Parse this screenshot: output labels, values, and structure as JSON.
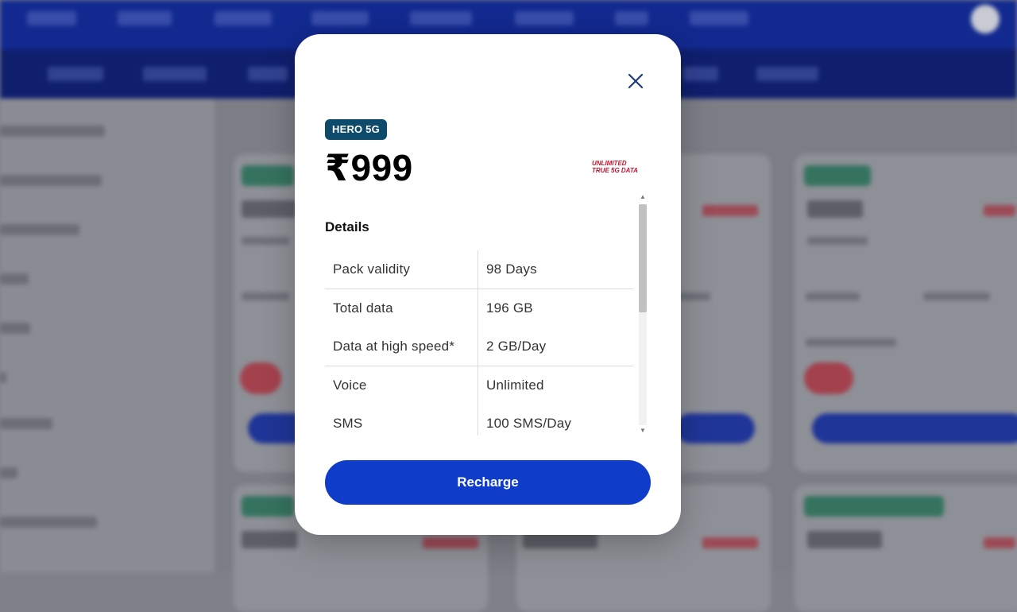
{
  "modal": {
    "badge": "HERO 5G",
    "price": "₹999",
    "tag_5g_line1": "UNLIMITED",
    "tag_5g_line2": "TRUE 5G DATA",
    "details_heading": "Details",
    "details": [
      {
        "label": "Pack validity",
        "value": "98 Days"
      },
      {
        "label": "Total data",
        "value": "196 GB"
      },
      {
        "label": "Data at high speed*",
        "value": "2 GB/Day"
      },
      {
        "label": "Voice",
        "value": "Unlimited"
      },
      {
        "label": "SMS",
        "value": "100 SMS/Day"
      }
    ],
    "recharge_label": "Recharge",
    "close_icon": "close-icon"
  },
  "colors": {
    "brand_blue": "#0f3cc9",
    "badge_teal": "#0e4b6b",
    "accent_red": "#c2132d"
  }
}
